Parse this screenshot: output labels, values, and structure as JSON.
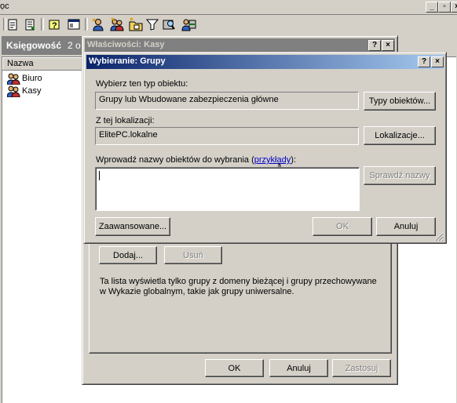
{
  "mmc": {
    "title_fragment": "ọc",
    "pane_title": "Księgowość",
    "pane_title_extra": "2 o",
    "column_name": "Nazwa",
    "items": [
      {
        "label": "Biuro",
        "icon": "group-icon"
      },
      {
        "label": "Kasy",
        "icon": "group-icon"
      }
    ],
    "toolbar_icons": [
      "properties-icon",
      "export-list-icon",
      "help-icon",
      "console-icon",
      "new-user-icon",
      "new-group-icon",
      "new-ou-icon",
      "filter-icon",
      "find-icon",
      "add-to-group-icon"
    ]
  },
  "props_dialog": {
    "title": "Właściwości: Kasy",
    "add_button": "Dodaj...",
    "remove_button": "Usuń",
    "info_text": "Ta lista wyświetla tylko grupy z domeny bieżącej i grupy przechowywane w Wykazie globalnym, takie jak grupy uniwersalne.",
    "ok_button": "OK",
    "cancel_button": "Anuluj",
    "apply_button": "Zastosuj"
  },
  "select_dialog": {
    "title": "Wybieranie: Grupy",
    "object_type_label": "Wybierz ten typ obiektu:",
    "object_type_value": "Grupy lub Wbudowane zabezpieczenia główne",
    "object_types_button": "Typy obiektów...",
    "location_label": "Z tej lokalizacji:",
    "location_value": "ElitePC.lokalne",
    "locations_button": "Lokalizacje...",
    "names_label_prefix": "Wprowadź nazwy obiektów do wybrania (",
    "names_label_link": "przykłady",
    "names_label_suffix": "):",
    "names_value": "",
    "check_names_button": "Sprawdź nazwy",
    "advanced_button": "Zaawansowane...",
    "ok_button": "OK",
    "cancel_button": "Anuluj"
  },
  "colors": {
    "title_active_start": "#0a246a",
    "title_active_end": "#a6caf0",
    "title_inactive": "#808080",
    "face": "#d4d0c8",
    "link": "#0000cc"
  }
}
